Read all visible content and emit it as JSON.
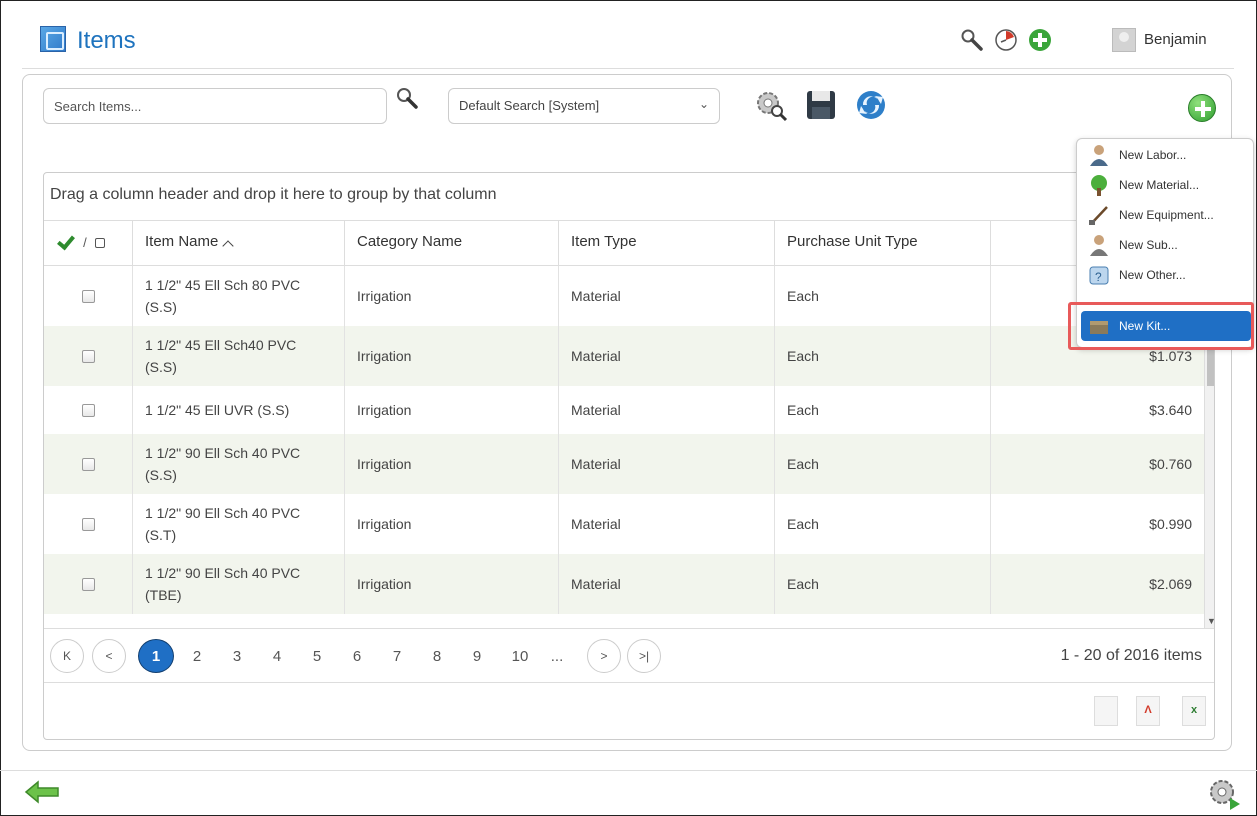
{
  "header": {
    "title": "Items",
    "user_name": "Benjamin",
    "icons": [
      "search-icon",
      "history-icon",
      "add-icon",
      "avatar"
    ]
  },
  "toolbar": {
    "search_placeholder": "Search Items...",
    "saved_search_value": "Default Search [System]"
  },
  "grid": {
    "group_hint": "Drag a column header and drop it here to group by that column",
    "columns": [
      "Item Name",
      "Category Name",
      "Item Type",
      "Purchase Unit Type"
    ],
    "select_separator": "/",
    "rows": [
      {
        "name": "1 1/2\" 45 Ell Sch 80 PVC (S.S)",
        "category": "Irrigation",
        "type": "Material",
        "unit": "Each",
        "price": ""
      },
      {
        "name": "1 1/2\" 45 Ell Sch40 PVC (S.S)",
        "category": "Irrigation",
        "type": "Material",
        "unit": "Each",
        "price": "$1.073"
      },
      {
        "name": "1 1/2\" 45 Ell UVR (S.S)",
        "category": "Irrigation",
        "type": "Material",
        "unit": "Each",
        "price": "$3.640"
      },
      {
        "name": "1 1/2\" 90 Ell Sch 40 PVC (S.S)",
        "category": "Irrigation",
        "type": "Material",
        "unit": "Each",
        "price": "$0.760"
      },
      {
        "name": "1 1/2\" 90 Ell Sch 40 PVC (S.T)",
        "category": "Irrigation",
        "type": "Material",
        "unit": "Each",
        "price": "$0.990"
      },
      {
        "name": "1 1/2\" 90 Ell Sch 40 PVC (TBE)",
        "category": "Irrigation",
        "type": "Material",
        "unit": "Each",
        "price": "$2.069"
      }
    ]
  },
  "pager": {
    "first_label": "K",
    "prev_label": "<",
    "next_label": ">",
    "last_label": ">|",
    "pages": [
      "1",
      "2",
      "3",
      "4",
      "5",
      "6",
      "7",
      "8",
      "9",
      "10",
      "..."
    ],
    "current_page": "1",
    "summary": "1 - 20 of 2016 items"
  },
  "add_menu": {
    "items": [
      "New Labor...",
      "New Material...",
      "New Equipment...",
      "New Sub...",
      "New Other...",
      "New Kit..."
    ],
    "selected": "New Kit..."
  },
  "colors": {
    "accent": "#1f6fc5",
    "title": "#1e73be",
    "alt_row": "#f2f5ed",
    "highlight": "#e85a5a"
  }
}
